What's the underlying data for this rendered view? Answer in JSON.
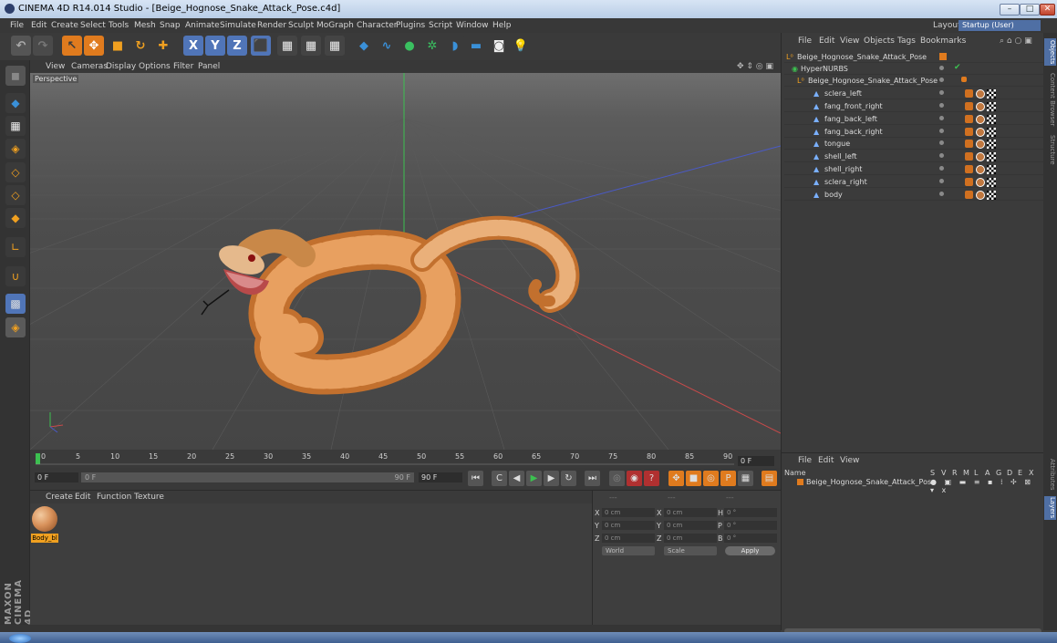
{
  "window": {
    "title": "CINEMA 4D R14.014 Studio - [Beige_Hognose_Snake_Attack_Pose.c4d]",
    "controls": [
      "–",
      "□",
      "✕"
    ]
  },
  "menu": {
    "items": [
      "File",
      "Edit",
      "Create",
      "Select",
      "Tools",
      "Mesh",
      "Snap",
      "Animate",
      "Simulate",
      "Render",
      "Sculpt",
      "MoGraph",
      "Character",
      "Plugins",
      "Script",
      "Window",
      "Help"
    ],
    "layout_label": "Layout:",
    "layout_value": "Startup (User)"
  },
  "toolbar": {
    "axis_labels": [
      "X",
      "Y",
      "Z"
    ],
    "colors": {
      "active": "#e07b1e",
      "axis": "#5075b8",
      "object": "#3a90d8"
    }
  },
  "viewport": {
    "menu": [
      "View",
      "Cameras",
      "Display",
      "Options",
      "Filter",
      "Panel"
    ],
    "camera_label": "Perspective"
  },
  "timeline": {
    "ticks": [
      "0",
      "5",
      "10",
      "15",
      "20",
      "25",
      "30",
      "35",
      "40",
      "45",
      "50",
      "55",
      "60",
      "65",
      "70",
      "75",
      "80",
      "85",
      "90"
    ],
    "current_frame": "0 F",
    "start_field": "0 F",
    "slider_start": "0 F",
    "slider_end": "90 F",
    "end_field": "90 F"
  },
  "material_manager": {
    "menu": [
      "Create",
      "Edit",
      "Function",
      "Texture"
    ],
    "material_name": "Body_bl"
  },
  "coordinates": {
    "header_left": "---",
    "header_mid": "---",
    "header_right": "---",
    "rows": [
      {
        "axis": "X",
        "pos": "0 cm",
        "size_axis": "X",
        "size": "0 cm",
        "rot_axis": "H",
        "rot": "0 °"
      },
      {
        "axis": "Y",
        "pos": "0 cm",
        "size_axis": "Y",
        "size": "0 cm",
        "rot_axis": "P",
        "rot": "0 °"
      },
      {
        "axis": "Z",
        "pos": "0 cm",
        "size_axis": "Z",
        "size": "0 cm",
        "rot_axis": "B",
        "rot": "0 °"
      }
    ],
    "mode": "World",
    "scale": "Scale",
    "apply": "Apply"
  },
  "object_manager": {
    "menu": [
      "File",
      "Edit",
      "View",
      "Objects",
      "Tags",
      "Bookmarks"
    ],
    "objects": [
      {
        "name": "Beige_Hognose_Snake_Attack_Pose",
        "icon": "null-icon"
      },
      {
        "name": "HyperNURBS",
        "icon": "hypernurbs-icon"
      },
      {
        "name": "Beige_Hognose_Snake_Attack_Pose",
        "icon": "null-icon"
      },
      {
        "name": "sclera_left",
        "icon": "polygon-icon"
      },
      {
        "name": "fang_front_right",
        "icon": "polygon-icon"
      },
      {
        "name": "fang_back_left",
        "icon": "polygon-icon"
      },
      {
        "name": "fang_back_right",
        "icon": "polygon-icon"
      },
      {
        "name": "tongue",
        "icon": "polygon-icon"
      },
      {
        "name": "shell_left",
        "icon": "polygon-icon"
      },
      {
        "name": "shell_right",
        "icon": "polygon-icon"
      },
      {
        "name": "sclera_right",
        "icon": "polygon-icon"
      },
      {
        "name": "body",
        "icon": "polygon-icon"
      }
    ]
  },
  "layer_manager": {
    "menu": [
      "File",
      "Edit",
      "View"
    ],
    "columns": {
      "name": "Name",
      "flags": [
        "S",
        "V",
        "R",
        "M",
        "L",
        "A",
        "G",
        "D",
        "E",
        "X"
      ]
    },
    "layer_name": "Beige_Hognose_Snake_Attack_Pose"
  },
  "side_tabs": [
    "Objects",
    "Content Browser",
    "Structure",
    "Attributes",
    "Layers"
  ],
  "brand": "MAXON CINEMA 4D"
}
